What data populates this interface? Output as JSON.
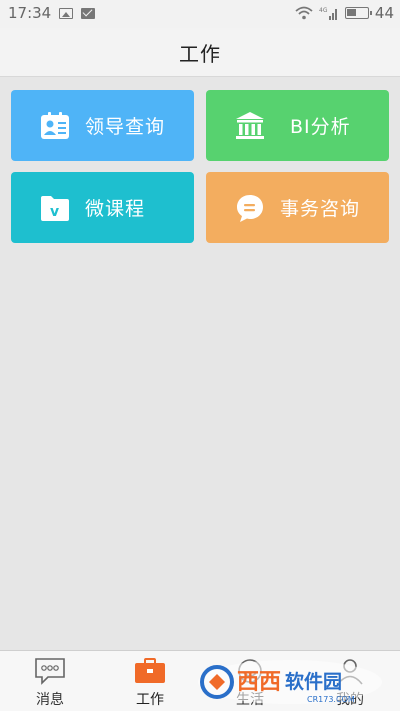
{
  "status_bar": {
    "time": "17:34",
    "signal_label": "4G",
    "battery": "44"
  },
  "header": {
    "title": "工作"
  },
  "tiles": [
    {
      "label": "领导查询",
      "color": "#4fb4f7",
      "icon": "contact-card-icon"
    },
    {
      "label": "BI分析",
      "color": "#57d26f",
      "icon": "bank-icon"
    },
    {
      "label": "微课程",
      "color": "#1ebfcf",
      "icon": "video-folder-icon"
    },
    {
      "label": "事务咨询",
      "color": "#f3ad5f",
      "icon": "chat-bubble-icon"
    }
  ],
  "nav": [
    {
      "label": "消息",
      "icon": "message-icon",
      "active": false
    },
    {
      "label": "工作",
      "icon": "briefcase-icon",
      "active": true,
      "color": "#f06a28"
    },
    {
      "label": "生活",
      "icon": "life-icon",
      "active": false
    },
    {
      "label": "我的",
      "icon": "profile-icon",
      "active": false
    }
  ],
  "watermark": {
    "text": "西西软件园",
    "sub": "CR173.COM"
  }
}
